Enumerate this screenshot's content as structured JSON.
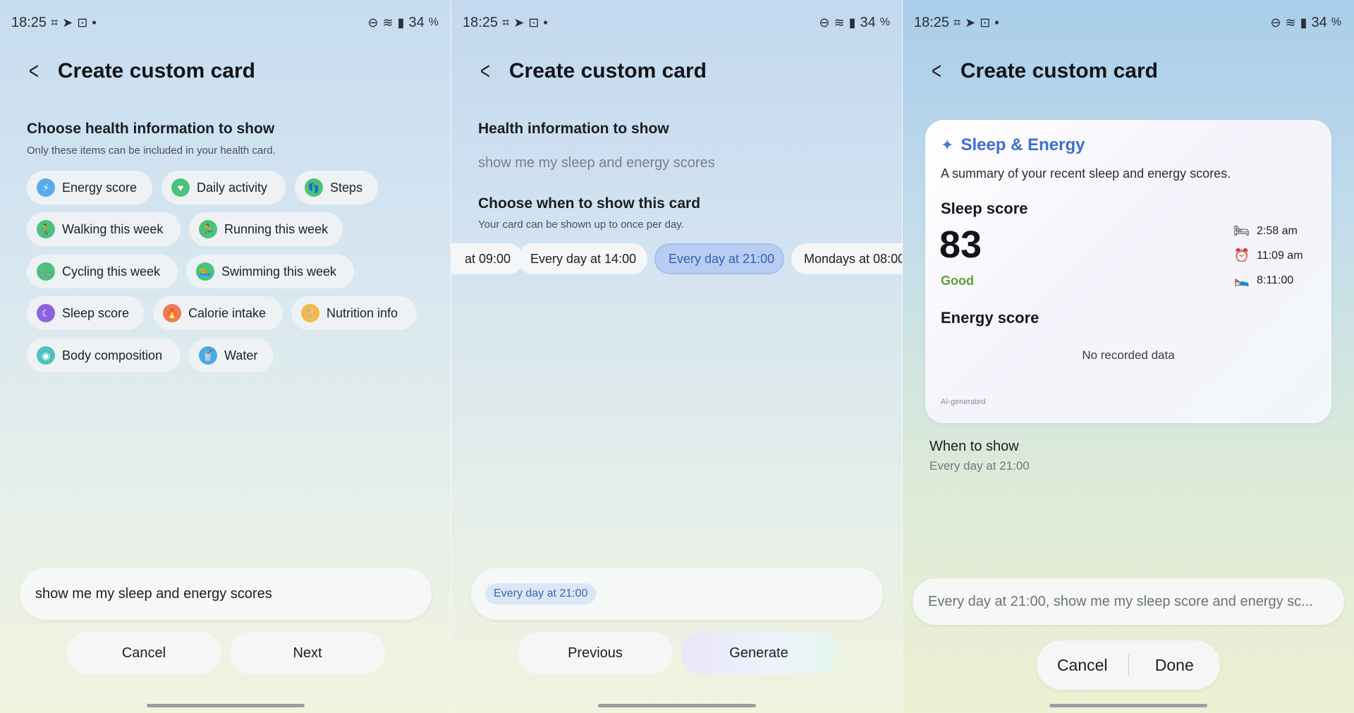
{
  "status": {
    "time": "18:25",
    "battery": "34",
    "battery_unit": "%",
    "icons": [
      "hash-icon",
      "telegram-icon",
      "screenshot-icon",
      "dot-icon",
      "dnd-icon",
      "wifi-icon",
      "signal-icon"
    ]
  },
  "common": {
    "page_title": "Create custom card",
    "back_glyph": "<"
  },
  "screen1": {
    "heading": "Choose health information to show",
    "subheading": "Only these items can be included in your health card.",
    "chips": [
      {
        "label": "Energy score",
        "color": "#5aa9ec",
        "glyph": "⚡"
      },
      {
        "label": "Daily activity",
        "color": "#4cc27a",
        "glyph": "♥"
      },
      {
        "label": "Steps",
        "color": "#4cc27a",
        "glyph": "👣"
      },
      {
        "label": "Walking this week",
        "color": "#4cc27a",
        "glyph": "🚶"
      },
      {
        "label": "Running this week",
        "color": "#4cc27a",
        "glyph": "🏃"
      },
      {
        "label": "Cycling this week",
        "color": "#4cc27a",
        "glyph": "🚲"
      },
      {
        "label": "Swimming this week",
        "color": "#4cc27a",
        "glyph": "🏊"
      },
      {
        "label": "Sleep score",
        "color": "#8a63e0",
        "glyph": "☾"
      },
      {
        "label": "Calorie intake",
        "color": "#ee7a5a",
        "glyph": "🔥"
      },
      {
        "label": "Nutrition info",
        "color": "#f3b74a",
        "glyph": "🍴"
      },
      {
        "label": "Body composition",
        "color": "#4cc2b8",
        "glyph": "◉"
      },
      {
        "label": "Water",
        "color": "#4aa8e8",
        "glyph": "🥤"
      }
    ],
    "input_text": "show me my sleep and energy scores",
    "cancel": "Cancel",
    "next": "Next"
  },
  "screen2": {
    "heading": "Health information to show",
    "query": "show me my sleep and energy scores",
    "when_heading": "Choose when to show this card",
    "when_sub": "Your card can be shown up to once per day.",
    "time_chips": [
      "at 09:00",
      "Every day at 14:00",
      "Every day at 21:00",
      "Mondays at 08:00"
    ],
    "selected_chip": "Every day at 21:00",
    "previous": "Previous",
    "generate": "Generate"
  },
  "screen3": {
    "card_title": "Sleep & Energy",
    "card_desc": "A summary of your recent sleep and energy scores.",
    "sleep_label": "Sleep score",
    "sleep_value": "83",
    "sleep_rating": "Good",
    "bedtime": "2:58 am",
    "wake": "11:09 am",
    "duration": "8:11:00",
    "energy_label": "Energy score",
    "no_data": "No recorded data",
    "ai_note": "AI-generated",
    "when_label": "When to show",
    "when_value": "Every day at 21:00",
    "input_text": "Every day at 21:00, show me my sleep score and energy sc...",
    "cancel": "Cancel",
    "done": "Done"
  }
}
